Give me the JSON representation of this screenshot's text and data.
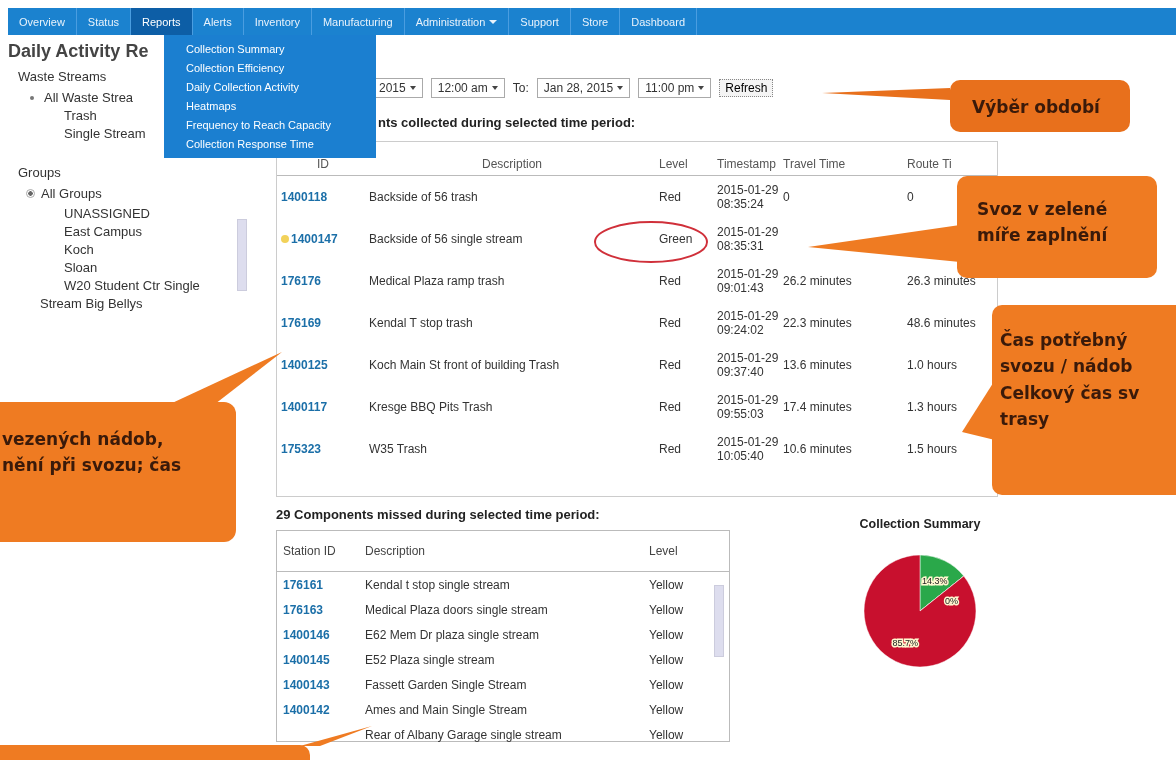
{
  "nav": {
    "tabs": [
      {
        "label": "Overview",
        "selected": false,
        "dropdown": false
      },
      {
        "label": "Status",
        "selected": false,
        "dropdown": false
      },
      {
        "label": "Reports",
        "selected": true,
        "dropdown": false
      },
      {
        "label": "Alerts",
        "selected": false,
        "dropdown": false
      },
      {
        "label": "Inventory",
        "selected": false,
        "dropdown": false
      },
      {
        "label": "Manufacturing",
        "selected": false,
        "dropdown": false
      },
      {
        "label": "Administration",
        "selected": false,
        "dropdown": true
      },
      {
        "label": "Support",
        "selected": false,
        "dropdown": false
      },
      {
        "label": "Store",
        "selected": false,
        "dropdown": false
      },
      {
        "label": "Dashboard",
        "selected": false,
        "dropdown": false
      }
    ]
  },
  "reports_menu": {
    "items": [
      "Collection Summary",
      "Collection Efficiency",
      "Daily Collection Activity",
      "Heatmaps",
      "Frequency to Reach Capacity",
      "Collection Response Time"
    ]
  },
  "page_title": "Daily Activity Re",
  "sidebar": {
    "waste_streams": {
      "heading": "Waste Streams",
      "options": [
        {
          "label": "All Waste Strea",
          "selected": true,
          "children": [
            {
              "label": "Trash"
            },
            {
              "label": "Single Stream"
            }
          ]
        }
      ]
    },
    "groups": {
      "heading": "Groups",
      "all": {
        "label": "All Groups",
        "selected": true
      },
      "items": [
        "UNASSIGNED",
        "East Campus",
        "Koch",
        "Sloan",
        "W20 Student Ctr Single Stream Big Bellys"
      ]
    }
  },
  "filters": {
    "from_date": "2015",
    "from_time": "12:00 am",
    "to_label": "To:",
    "to_date": "Jan 28, 2015",
    "to_time": "11:00 pm",
    "refresh": "Refresh"
  },
  "collected": {
    "heading": "nts collected during selected time period:",
    "columns": [
      "ID",
      "Description",
      "Level",
      "Timestamp",
      "Travel Time",
      "Route Ti"
    ],
    "rows": [
      {
        "id": "1400118",
        "description": "Backside of 56 trash",
        "level": "Red",
        "timestamp": "2015-01-29 08:35:24",
        "travel_time": "0",
        "route_time": "0",
        "warning": false,
        "circled": false
      },
      {
        "id": "1400147",
        "description": "Backside of 56 single stream",
        "level": "Green",
        "timestamp": "2015-01-29 08:35:31",
        "warning": true,
        "circled": true
      },
      {
        "id": "176176",
        "description": "Medical Plaza ramp trash",
        "level": "Red",
        "timestamp": "2015-01-29 09:01:43",
        "travel_time": "26.2 minutes",
        "route_time": "26.3 minutes",
        "warning": false,
        "circled": false
      },
      {
        "id": "176169",
        "description": "Kendal T stop trash",
        "level": "Red",
        "timestamp": "2015-01-29 09:24:02",
        "travel_time": "22.3 minutes",
        "route_time": "48.6 minutes",
        "warning": false,
        "circled": false
      },
      {
        "id": "1400125",
        "description": "Koch Main St front of building Trash",
        "level": "Red",
        "timestamp": "2015-01-29 09:37:40",
        "travel_time": "13.6 minutes",
        "route_time": "1.0 hours",
        "warning": false,
        "circled": false
      },
      {
        "id": "1400117",
        "description": "Kresge BBQ Pits Trash",
        "level": "Red",
        "timestamp": "2015-01-29 09:55:03",
        "travel_time": "17.4 minutes",
        "route_time": "1.3 hours",
        "warning": false,
        "circled": false
      },
      {
        "id": "175323",
        "description": "W35 Trash",
        "level": "Red",
        "timestamp": "2015-01-29 10:05:40",
        "travel_time": "10.6 minutes",
        "route_time": "1.5 hours",
        "warning": false,
        "circled": false
      }
    ]
  },
  "missed": {
    "heading": "29 Components missed during selected time period:",
    "columns": [
      "Station ID",
      "Description",
      "Level"
    ],
    "rows": [
      {
        "id": "176161",
        "description": "Kendal t stop single stream",
        "level": "Yellow"
      },
      {
        "id": "176163",
        "description": "Medical Plaza doors single stream",
        "level": "Yellow"
      },
      {
        "id": "1400146",
        "description": "E62 Mem Dr plaza single stream",
        "level": "Yellow"
      },
      {
        "id": "1400145",
        "description": "E52 Plaza single stream",
        "level": "Yellow"
      },
      {
        "id": "1400143",
        "description": "Fassett Garden Single Stream",
        "level": "Yellow"
      },
      {
        "id": "1400142",
        "description": "Ames and Main Single Stream",
        "level": "Yellow"
      },
      {
        "description": "Rear of Albany Garage single stream",
        "level": "Yellow"
      }
    ]
  },
  "summary": {
    "chart_data": {
      "type": "pie",
      "title": "Collection Summary",
      "values": [
        14.3,
        0,
        85.7
      ],
      "value_labels": [
        "14.3%",
        "0%",
        "85.7%"
      ]
    }
  },
  "callouts": [
    {
      "text": "Výběr období"
    },
    {
      "text": "Svoz v zelené\nmíře zaplnění"
    },
    {
      "text": "Čas potřebný\nsvozu / nádob\nCelkový čas sv\ntrasy"
    },
    {
      "text": "vezených nádob,\nnění při svozu; čas"
    }
  ]
}
